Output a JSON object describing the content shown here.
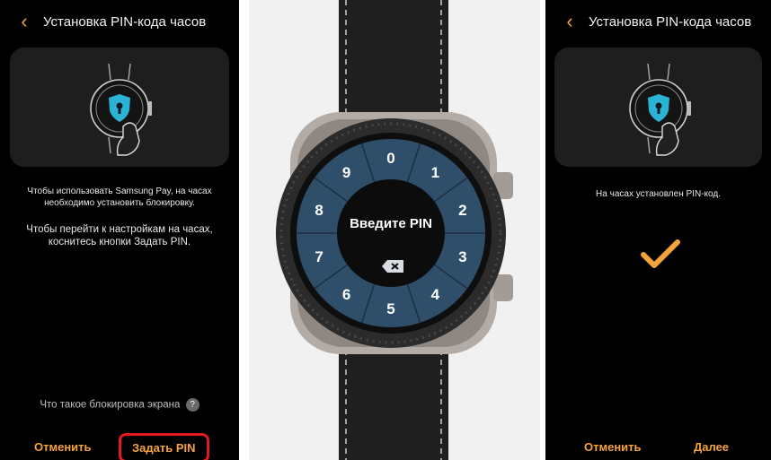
{
  "left_screen": {
    "title": "Установка PIN-кода часов",
    "message_1": "Чтобы использовать Samsung Pay, на часах необходимо установить блокировку.",
    "message_2": "Чтобы перейти к настройкам на часах, коснитесь кнопки Задать PIN.",
    "help_link": "Что такое блокировка экрана",
    "help_icon": "?",
    "cancel_button": "Отменить",
    "set_pin_button": "Задать PIN"
  },
  "watch": {
    "prompt": "Введите PIN",
    "digits": [
      "0",
      "1",
      "2",
      "3",
      "4",
      "5",
      "6",
      "7",
      "8",
      "9"
    ]
  },
  "right_screen": {
    "title": "Установка PIN-кода часов",
    "message": "На часах установлен PIN-код.",
    "cancel_button": "Отменить",
    "next_button": "Далее"
  },
  "colors": {
    "accent": "#f5a33c",
    "highlight_border": "#e21b1b",
    "shield": "#2bb3d6",
    "watch_face": "#2f4e6a"
  }
}
